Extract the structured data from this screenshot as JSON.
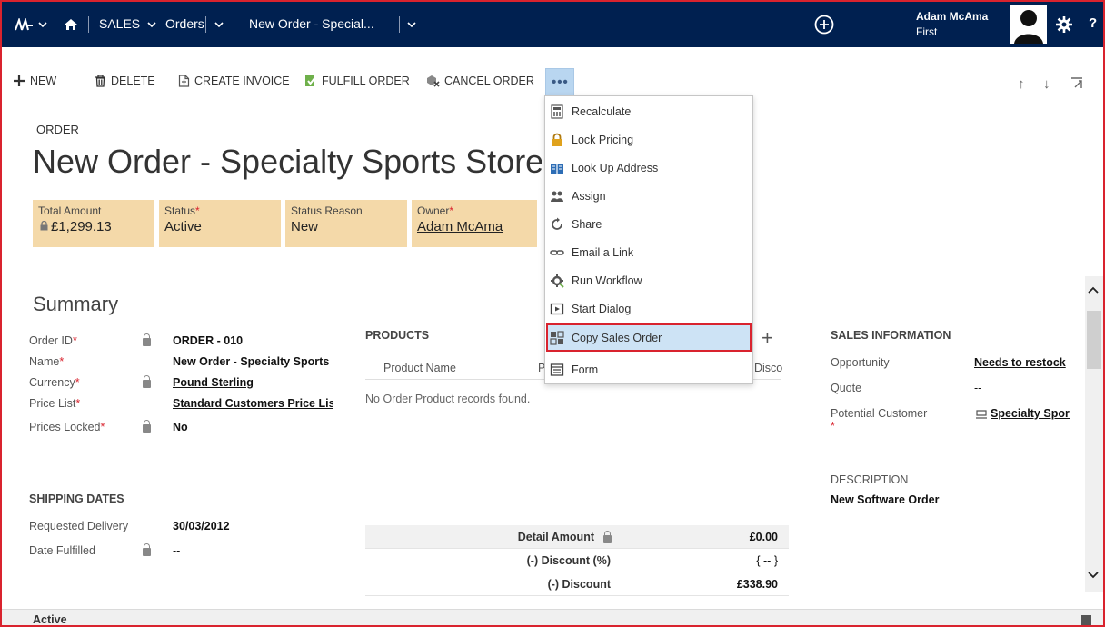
{
  "nav": {
    "sales_label": "SALES",
    "orders_label": "Orders",
    "record_label": "New Order - Special...",
    "user_name": "Adam McAma",
    "user_org": "First",
    "help_label": "?"
  },
  "commands": {
    "new": "NEW",
    "delete": "DELETE",
    "create_invoice": "CREATE INVOICE",
    "fulfill_order": "FULFILL ORDER",
    "cancel_order": "CANCEL ORDER",
    "more": "•••"
  },
  "record": {
    "type": "ORDER",
    "title": "New Order - Specialty Sports Store"
  },
  "tiles": [
    {
      "label": "Total Amount",
      "required": "",
      "value": "£1,299.13"
    },
    {
      "label": "Status",
      "required": "*",
      "value": "Active"
    },
    {
      "label": "Status Reason",
      "required": "",
      "value": "New"
    },
    {
      "label": "Owner",
      "required": "*",
      "value": "Adam McAma"
    }
  ],
  "summary": {
    "title": "Summary",
    "fields": [
      {
        "label": "Order ID",
        "required": "*",
        "value": "ORDER - 010"
      },
      {
        "label": "Name",
        "required": "*",
        "value": "New Order - Specialty Sports Store"
      },
      {
        "label": "Currency",
        "required": "*",
        "value": "Pound Sterling"
      },
      {
        "label": "Price List",
        "required": "*",
        "value": "Standard Customers Price List"
      },
      {
        "label": "Prices Locked",
        "required": "*",
        "value": "No"
      }
    ]
  },
  "shipping": {
    "title": "SHIPPING DATES",
    "fields": [
      {
        "label": "Requested Delivery",
        "value": "30/03/2012"
      },
      {
        "label": "Date Fulfilled",
        "value": "--"
      }
    ]
  },
  "products": {
    "title": "PRODUCTS",
    "columns": [
      "Product Name",
      "P",
      "Disco"
    ],
    "empty_message": "No Order Product records found.",
    "totals": [
      {
        "label": "Detail Amount",
        "value": "£0.00"
      },
      {
        "label": "(-) Discount (%)",
        "value": "{ -- }"
      },
      {
        "label": "(-) Discount",
        "value": "£338.90"
      }
    ]
  },
  "sales_info": {
    "title": "SALES INFORMATION",
    "fields": [
      {
        "label": "Opportunity",
        "value": "Needs to restock"
      },
      {
        "label": "Quote",
        "value": "--"
      },
      {
        "label": "Potential Customer",
        "required": "*",
        "value": "Specialty Sports Store"
      }
    ],
    "description_label": "DESCRIPTION",
    "description_value": "New Software Order"
  },
  "menu": {
    "items": [
      {
        "label": "Recalculate",
        "icon": "calculator-icon"
      },
      {
        "label": "Lock Pricing",
        "icon": "lock-icon"
      },
      {
        "label": "Look Up Address",
        "icon": "address-book-icon"
      },
      {
        "label": "Assign",
        "icon": "assign-icon"
      },
      {
        "label": "Share",
        "icon": "share-icon"
      },
      {
        "label": "Email a Link",
        "icon": "link-icon"
      },
      {
        "label": "Run Workflow",
        "icon": "workflow-icon"
      },
      {
        "label": "Start Dialog",
        "icon": "dialog-icon"
      },
      {
        "label": "Copy Sales Order",
        "icon": "copy-order-icon"
      },
      {
        "label": "Form",
        "icon": "form-icon"
      }
    ]
  },
  "footer": {
    "status": "Active"
  },
  "colors": {
    "nav_bg": "#002050",
    "tile_bg": "#f4d9a9",
    "highlight_border": "#d9232e",
    "menu_highlight": "#cde3f5"
  }
}
